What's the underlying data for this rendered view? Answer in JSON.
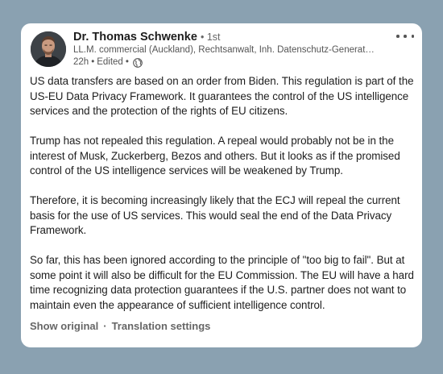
{
  "post": {
    "author_name": "Dr. Thomas Schwenke",
    "degree": "1st",
    "headline": "LL.M. commercial (Auckland), Rechtsanwalt, Inh. Datenschutz-Generator…",
    "time": "22h",
    "edited": "Edited",
    "visibility_icon": "globe-icon",
    "paragraphs": [
      "US data transfers are based on an order from Biden. This regulation is part of the US-EU Data Privacy Framework. It guarantees the control of the US intelligence services and the protection of the rights of EU citizens.",
      "Trump has not repealed this regulation. A repeal would probably not be in the interest of Musk, Zuckerberg, Bezos and others. But it looks as if the promised control of the US intelligence services will be weakened by Trump.",
      "Therefore, it is becoming increasingly likely that the ECJ will repeal the current basis for the use of US services. This would seal the end of the Data Privacy Framework.",
      "So far, this has been ignored according to the principle of \"too big to fail\". But at some point it will also be difficult for the EU Commission. The EU will have a hard time recognizing data protection guarantees if the U.S. partner does not want to maintain even the appearance of sufficient intelligence control."
    ]
  },
  "footer": {
    "show_original": "Show original",
    "translation_settings": "Translation settings"
  },
  "colors": {
    "background": "#8aa1b1",
    "card": "#ffffff",
    "text": "#1d1d1d",
    "muted": "#666666"
  }
}
